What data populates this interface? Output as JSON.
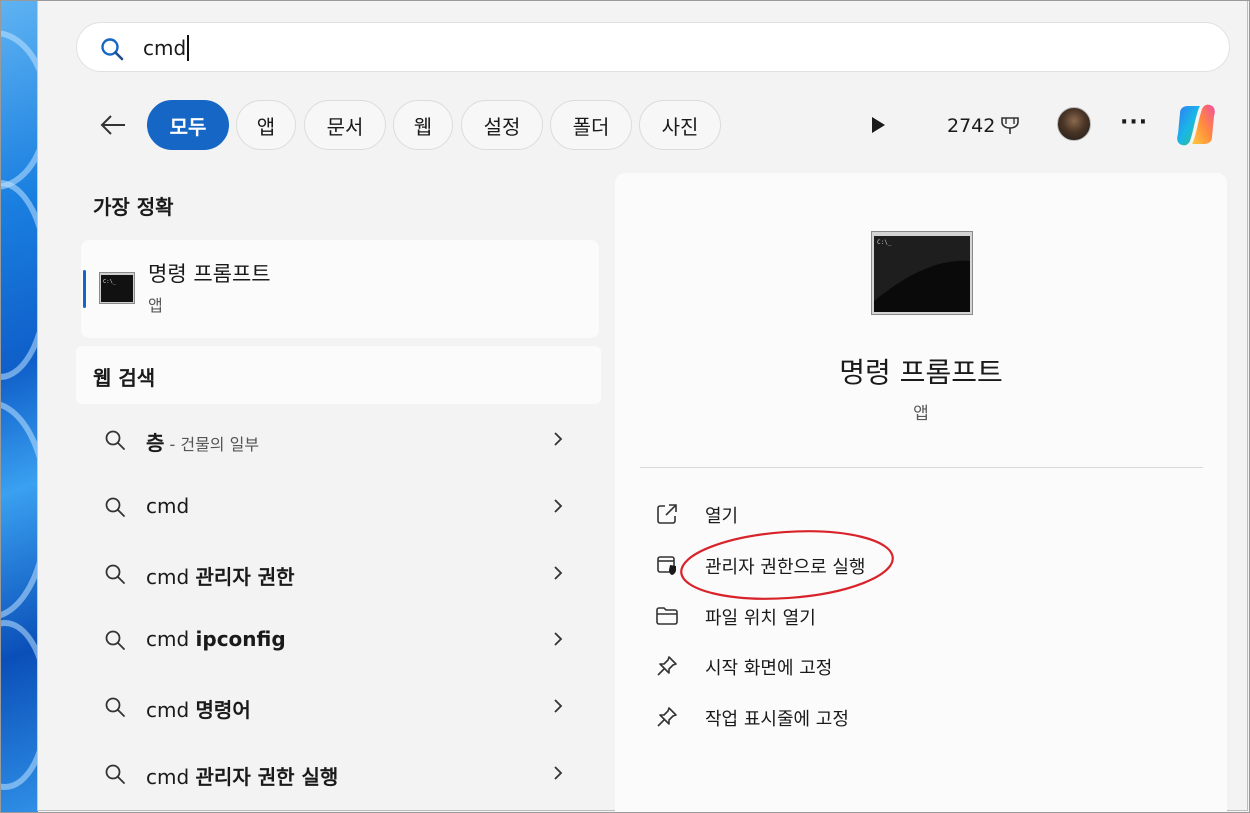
{
  "search": {
    "query": "cmd"
  },
  "filters": {
    "tabs": [
      {
        "label": "모두",
        "active": true
      },
      {
        "label": "앱",
        "active": false
      },
      {
        "label": "문서",
        "active": false
      },
      {
        "label": "웹",
        "active": false
      },
      {
        "label": "설정",
        "active": false
      },
      {
        "label": "폴더",
        "active": false
      },
      {
        "label": "사진",
        "active": false
      }
    ],
    "points": "2742"
  },
  "best_match": {
    "heading": "가장 정확",
    "app_name": "명령 프롬프트",
    "app_type": "앱"
  },
  "web_search": {
    "heading": "웹 검색",
    "items": [
      {
        "plain": "",
        "bold": "층",
        "sub": " - 건물의 일부"
      },
      {
        "plain": "cmd",
        "bold": "",
        "sub": ""
      },
      {
        "plain": "cmd ",
        "bold": "관리자 권한",
        "sub": ""
      },
      {
        "plain": "cmd ",
        "bold": "ipconfig",
        "sub": ""
      },
      {
        "plain": "cmd ",
        "bold": "명령어",
        "sub": ""
      },
      {
        "plain": "cmd ",
        "bold": "관리자 권한 실행",
        "sub": ""
      }
    ]
  },
  "detail": {
    "app_name": "명령 프롬프트",
    "app_type": "앱",
    "actions": [
      {
        "label": "열기",
        "icon": "open-external-icon"
      },
      {
        "label": "관리자 권한으로 실행",
        "icon": "admin-shield-icon"
      },
      {
        "label": "파일 위치 열기",
        "icon": "folder-icon"
      },
      {
        "label": "시작 화면에 고정",
        "icon": "pin-icon"
      },
      {
        "label": "작업 표시줄에 고정",
        "icon": "pin-icon"
      }
    ]
  },
  "colors": {
    "accent": "#1667c5",
    "highlight_annotation": "#d9232a"
  }
}
